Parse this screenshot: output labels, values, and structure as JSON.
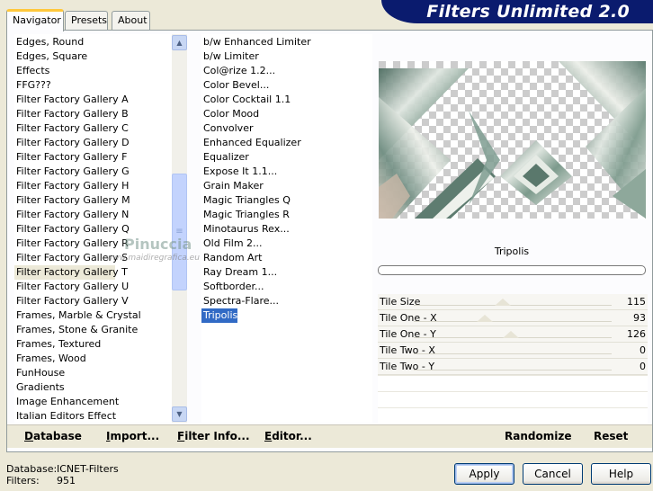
{
  "tabs": [
    {
      "label": "Navigator",
      "active": true
    },
    {
      "label": "Presets",
      "active": false
    },
    {
      "label": "About",
      "active": false
    }
  ],
  "logo": "Filters Unlimited 2.0",
  "categories": [
    "Edges, Round",
    "Edges, Square",
    "Effects",
    "FFG???",
    "Filter Factory Gallery A",
    "Filter Factory Gallery B",
    "Filter Factory Gallery C",
    "Filter Factory Gallery D",
    "Filter Factory Gallery F",
    "Filter Factory Gallery G",
    "Filter Factory Gallery H",
    "Filter Factory Gallery M",
    "Filter Factory Gallery N",
    "Filter Factory Gallery Q",
    "Filter Factory Gallery R",
    "Filter Factory Gallery S",
    "Filter Factory Gallery T",
    "Filter Factory Gallery U",
    "Filter Factory Gallery V",
    "Frames, Marble & Crystal",
    "Frames, Stone & Granite",
    "Frames, Textured",
    "Frames, Wood",
    "FunHouse",
    "Gradients",
    "Image Enhancement",
    "Italian Editors Effect"
  ],
  "selected_category": "Filter Factory Gallery T",
  "filters": [
    "b/w Enhanced Limiter",
    "b/w Limiter",
    "Col@rize 1.2...",
    "Color Bevel...",
    "Color Cocktail 1.1",
    "Color Mood",
    "Convolver",
    "Enhanced Equalizer",
    "Equalizer",
    "Expose It 1.1...",
    "Grain Maker",
    "Magic Triangles Q",
    "Magic Triangles R",
    "Minotaurus Rex...",
    "Old Film 2...",
    "Random Art",
    "Ray Dream 1...",
    "Softborder...",
    "Spectra-Flare...",
    "Tripolis"
  ],
  "selected_filter": "Tripolis",
  "current_filter_name": "Tripolis",
  "watermark": {
    "name": "Pinuccia",
    "site": "www.maidiregrafica.eu"
  },
  "parameters": [
    {
      "label": "Tile Size",
      "value": "115",
      "fraction": 0.45
    },
    {
      "label": "Tile One - X",
      "value": "93",
      "fraction": 0.36
    },
    {
      "label": "Tile One - Y",
      "value": "126",
      "fraction": 0.49
    },
    {
      "label": "Tile Two - X",
      "value": "0",
      "fraction": 0.0
    },
    {
      "label": "Tile Two - Y",
      "value": "0",
      "fraction": 0.0
    }
  ],
  "actions": {
    "database": "Database",
    "import": "Import...",
    "filter_info": "Filter Info...",
    "editor": "Editor...",
    "randomize": "Randomize",
    "reset": "Reset"
  },
  "info": {
    "database_label": "Database:",
    "database_value": "ICNET-Filters",
    "filters_label": "Filters:",
    "filters_value": "951"
  },
  "buttons": {
    "apply": "Apply",
    "cancel": "Cancel",
    "help": "Help"
  },
  "colors": {
    "selection": "#316ac5",
    "logo_band": "#0a1b6e",
    "tab_accent": "#ffc83c"
  }
}
